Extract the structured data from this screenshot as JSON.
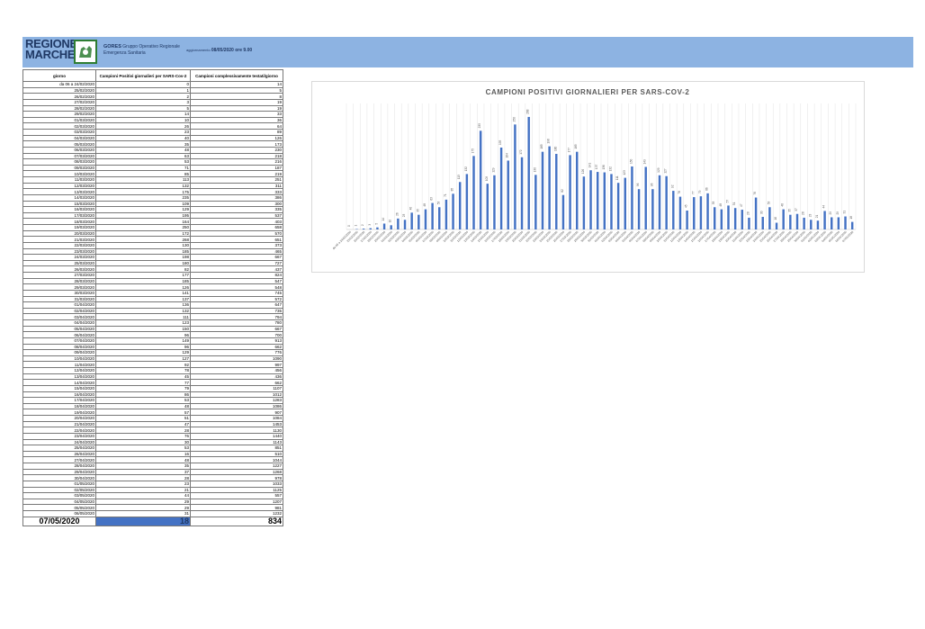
{
  "header": {
    "logo_line1": "REGIONE",
    "logo_line2": "MARCHE",
    "gores_name": "GORES",
    "gores_line1": "Gruppo Operativo Regionale",
    "gores_line2": "Emergenza Sanitaria",
    "update_label": "aggiornamento",
    "update_value": "08/05/2020 ore 9.00",
    "banner_color": "#8db3e2"
  },
  "table": {
    "headers": [
      "giorno",
      "Campioni Positivi giornalieri per SARS-Cov-2",
      "Campioni complessivamente testati/giorno"
    ],
    "rows": [
      [
        "da 06 a 24/02/2020",
        "0",
        "14"
      ],
      [
        "25/02/2020",
        "1",
        "5"
      ],
      [
        "26/02/2020",
        "2",
        "8"
      ],
      [
        "27/02/2020",
        "3",
        "19"
      ],
      [
        "28/02/2020",
        "5",
        "19"
      ],
      [
        "29/02/2020",
        "14",
        "33"
      ],
      [
        "01/03/2020",
        "10",
        "36"
      ],
      [
        "02/03/2020",
        "26",
        "64"
      ],
      [
        "03/03/2020",
        "23",
        "89"
      ],
      [
        "04/03/2020",
        "40",
        "126"
      ],
      [
        "05/03/2020",
        "35",
        "173"
      ],
      [
        "06/03/2020",
        "48",
        "230"
      ],
      [
        "07/03/2020",
        "63",
        "218"
      ],
      [
        "08/03/2020",
        "53",
        "216"
      ],
      [
        "09/03/2020",
        "71",
        "187"
      ],
      [
        "10/03/2020",
        "85",
        "219"
      ],
      [
        "11/03/2020",
        "113",
        "251"
      ],
      [
        "12/03/2020",
        "132",
        "311"
      ],
      [
        "13/03/2020",
        "175",
        "333"
      ],
      [
        "14/03/2020",
        "235",
        "386"
      ],
      [
        "15/03/2020",
        "109",
        "300"
      ],
      [
        "16/03/2020",
        "129",
        "335"
      ],
      [
        "17/03/2020",
        "195",
        "537"
      ],
      [
        "18/03/2020",
        "164",
        "403"
      ],
      [
        "19/03/2020",
        "250",
        "658"
      ],
      [
        "20/03/2020",
        "172",
        "570"
      ],
      [
        "21/03/2020",
        "268",
        "651"
      ],
      [
        "22/03/2020",
        "130",
        "373"
      ],
      [
        "23/03/2020",
        "185",
        "465"
      ],
      [
        "24/03/2020",
        "198",
        "667"
      ],
      [
        "25/03/2020",
        "180",
        "727"
      ],
      [
        "26/03/2020",
        "82",
        "437"
      ],
      [
        "27/03/2020",
        "177",
        "824"
      ],
      [
        "28/03/2020",
        "185",
        "547"
      ],
      [
        "29/03/2020",
        "126",
        "548"
      ],
      [
        "30/03/2020",
        "141",
        "745"
      ],
      [
        "31/03/2020",
        "137",
        "572"
      ],
      [
        "01/04/2020",
        "136",
        "647"
      ],
      [
        "02/04/2020",
        "132",
        "735"
      ],
      [
        "03/04/2020",
        "111",
        "794"
      ],
      [
        "04/04/2020",
        "123",
        "780"
      ],
      [
        "05/04/2020",
        "150",
        "667"
      ],
      [
        "06/04/2020",
        "96",
        "700"
      ],
      [
        "07/04/2020",
        "149",
        "913"
      ],
      [
        "08/04/2020",
        "96",
        "662"
      ],
      [
        "09/04/2020",
        "129",
        "776"
      ],
      [
        "10/04/2020",
        "127",
        "1090"
      ],
      [
        "11/04/2020",
        "92",
        "997"
      ],
      [
        "12/04/2020",
        "78",
        "456"
      ],
      [
        "13/04/2020",
        "45",
        "436"
      ],
      [
        "14/04/2020",
        "77",
        "662"
      ],
      [
        "15/04/2020",
        "79",
        "1107"
      ],
      [
        "16/04/2020",
        "86",
        "1012"
      ],
      [
        "17/04/2020",
        "53",
        "1283"
      ],
      [
        "18/04/2020",
        "48",
        "1086"
      ],
      [
        "19/04/2020",
        "57",
        "907"
      ],
      [
        "20/04/2020",
        "51",
        "1084"
      ],
      [
        "21/04/2020",
        "47",
        "1453"
      ],
      [
        "22/04/2020",
        "28",
        "1130"
      ],
      [
        "23/04/2020",
        "76",
        "1440"
      ],
      [
        "24/04/2020",
        "30",
        "1143"
      ],
      [
        "25/04/2020",
        "53",
        "851"
      ],
      [
        "26/04/2020",
        "16",
        "510"
      ],
      [
        "27/04/2020",
        "48",
        "1044"
      ],
      [
        "28/04/2020",
        "35",
        "1227"
      ],
      [
        "29/04/2020",
        "37",
        "1268"
      ],
      [
        "30/04/2020",
        "28",
        "978"
      ],
      [
        "01/05/2020",
        "23",
        "1033"
      ],
      [
        "02/05/2020",
        "21",
        "1125"
      ],
      [
        "03/05/2020",
        "44",
        "557"
      ],
      [
        "04/05/2020",
        "29",
        "1207"
      ],
      [
        "05/05/2020",
        "29",
        "981"
      ],
      [
        "06/05/2020",
        "31",
        "1232"
      ]
    ],
    "last_row": [
      "07/05/2020",
      "18",
      "834"
    ]
  },
  "chart_data": {
    "type": "bar",
    "title": "CAMPIONI POSITIVI GIORNALIERI PER SARS-COV-2",
    "xlabel": "",
    "ylabel": "",
    "grid": true,
    "bar_color": "#4472c4",
    "categories": [
      "da 06 a 24/02/2020",
      "25/02/2020",
      "26/02/2020",
      "27/02/2020",
      "28/02/2020",
      "29/02/2020",
      "01/03/2020",
      "02/03/2020",
      "03/03/2020",
      "04/03/2020",
      "05/03/2020",
      "06/03/2020",
      "07/03/2020",
      "08/03/2020",
      "09/03/2020",
      "10/03/2020",
      "11/03/2020",
      "12/03/2020",
      "13/03/2020",
      "14/03/2020",
      "15/03/2020",
      "16/03/2020",
      "17/03/2020",
      "18/03/2020",
      "19/03/2020",
      "20/03/2020",
      "21/03/2020",
      "22/03/2020",
      "23/03/2020",
      "24/03/2020",
      "25/03/2020",
      "26/03/2020",
      "27/03/2020",
      "28/03/2020",
      "29/03/2020",
      "30/03/2020",
      "31/03/2020",
      "01/04/2020",
      "02/04/2020",
      "03/04/2020",
      "04/04/2020",
      "05/04/2020",
      "06/04/2020",
      "07/04/2020",
      "08/04/2020",
      "09/04/2020",
      "10/04/2020",
      "11/04/2020",
      "12/04/2020",
      "13/04/2020",
      "14/04/2020",
      "15/04/2020",
      "16/04/2020",
      "17/04/2020",
      "18/04/2020",
      "19/04/2020",
      "20/04/2020",
      "21/04/2020",
      "22/04/2020",
      "23/04/2020",
      "24/04/2020",
      "25/04/2020",
      "26/04/2020",
      "27/04/2020",
      "28/04/2020",
      "29/04/2020",
      "30/04/2020",
      "01/05/2020",
      "02/05/2020",
      "03/05/2020",
      "04/05/2020",
      "05/05/2020",
      "06/05/2020",
      "07/05/2020"
    ],
    "values": [
      0,
      1,
      2,
      3,
      5,
      14,
      10,
      26,
      23,
      40,
      35,
      48,
      63,
      53,
      71,
      85,
      113,
      132,
      175,
      235,
      109,
      129,
      195,
      164,
      250,
      172,
      268,
      130,
      185,
      198,
      180,
      82,
      177,
      185,
      126,
      141,
      137,
      136,
      132,
      111,
      123,
      150,
      96,
      149,
      96,
      129,
      127,
      92,
      78,
      45,
      77,
      79,
      86,
      53,
      48,
      57,
      51,
      47,
      28,
      76,
      30,
      53,
      16,
      48,
      35,
      37,
      28,
      23,
      21,
      44,
      29,
      29,
      31,
      18
    ],
    "ylim": [
      0,
      300
    ]
  }
}
